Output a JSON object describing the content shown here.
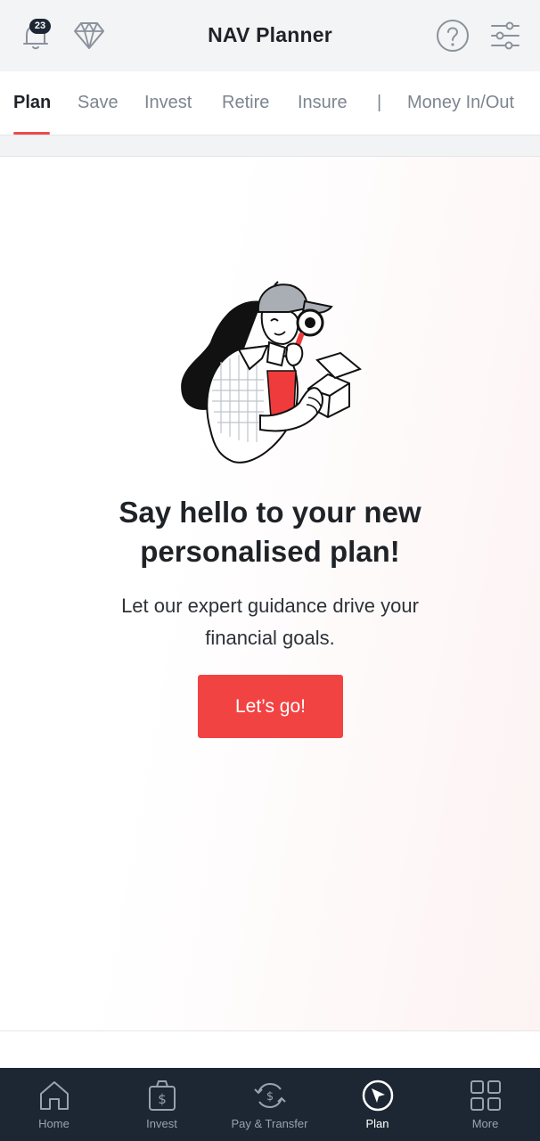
{
  "header": {
    "title": "NAV Planner",
    "notification_count": "23",
    "icons": [
      "bell-icon",
      "diamond-icon",
      "help-icon",
      "sliders-icon"
    ]
  },
  "tabs": [
    {
      "label": "Plan",
      "active": true
    },
    {
      "label": "Save"
    },
    {
      "label": "Invest"
    },
    {
      "label": "Retire"
    },
    {
      "label": "Insure"
    },
    {
      "label": "Money In/Out"
    }
  ],
  "tab_separator": "|",
  "main": {
    "headline_line1": "Say hello to your new",
    "headline_line2": "personalised plan!",
    "sub_line1": "Let our expert guidance drive your",
    "sub_line2": "financial goals.",
    "cta_label": "Let’s go!"
  },
  "bottom_nav": [
    {
      "label": "Home",
      "icon": "home-icon"
    },
    {
      "label": "Invest",
      "icon": "money-bag-icon"
    },
    {
      "label": "Pay & Transfer",
      "icon": "transfer-icon"
    },
    {
      "label": "Plan",
      "icon": "cursor-circle-icon",
      "active": true
    },
    {
      "label": "More",
      "icon": "grid-icon"
    }
  ],
  "colors": {
    "accent": "#f24343",
    "nav_bg": "#1c2733",
    "header_bg": "#f3f4f6"
  }
}
